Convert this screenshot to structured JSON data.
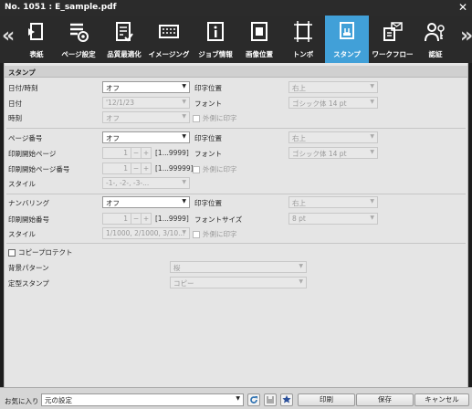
{
  "window": {
    "title": "No. 1051 : E_sample.pdf",
    "close_glyph": "✕"
  },
  "toolbar": {
    "tabs": [
      {
        "label": "表紙",
        "icon": "cover-icon"
      },
      {
        "label": "ページ設定",
        "icon": "page-settings-icon"
      },
      {
        "label": "品質最適化",
        "icon": "quality-icon"
      },
      {
        "label": "イメージング",
        "icon": "imaging-icon"
      },
      {
        "label": "ジョブ情報",
        "icon": "job-info-icon"
      },
      {
        "label": "画像位置",
        "icon": "image-position-icon"
      },
      {
        "label": "トンボ",
        "icon": "trim-marks-icon"
      },
      {
        "label": "スタンプ",
        "icon": "stamp-icon"
      },
      {
        "label": "ワークフロー",
        "icon": "workflow-icon"
      },
      {
        "label": "認証",
        "icon": "auth-icon"
      }
    ],
    "active_tab": "スタンプ",
    "accent": "#41a0d8"
  },
  "stamp": {
    "section_title": "スタンプ",
    "datetime": {
      "label": "日付/時刻",
      "value": "オフ",
      "position_label": "印字位置",
      "position_value": "右上",
      "date_label": "日付",
      "date_value": "'12/1/23",
      "font_label": "フォント",
      "font_value": "ゴシック体 14 pt",
      "time_label": "時刻",
      "time_value": "オフ",
      "outside_label": "外側に印字"
    },
    "page_number": {
      "label": "ページ番号",
      "value": "オフ",
      "position_label": "印字位置",
      "position_value": "右上",
      "start_page_label": "印刷開始ページ",
      "start_page_value": "1",
      "start_page_range": "[1...9999]",
      "font_label": "フォント",
      "font_value": "ゴシック体 14 pt",
      "start_number_label": "印刷開始ページ番号",
      "start_number_value": "1",
      "start_number_range": "[1...99999]",
      "outside_label": "外側に印字",
      "style_label": "スタイル",
      "style_value": "-1-, -2-, -3-..."
    },
    "numbering": {
      "label": "ナンバリング",
      "value": "オフ",
      "position_label": "印字位置",
      "position_value": "右上",
      "start_label": "印刷開始番号",
      "start_value": "1",
      "start_range": "[1...9999]",
      "font_size_label": "フォントサイズ",
      "font_size_value": "8 pt",
      "style_label": "スタイル",
      "style_value": "1/1000, 2/1000, 3/10...",
      "outside_label": "外側に印字"
    },
    "copy_protect": {
      "label": "コピープロテクト",
      "background_label": "背景パターン",
      "background_value": "桜",
      "fixed_stamp_label": "定型スタンプ",
      "fixed_stamp_value": "コピー"
    }
  },
  "footer": {
    "favorites_label": "お気に入り",
    "favorites_value": "元の設定",
    "print_label": "印刷",
    "save_label": "保存",
    "cancel_label": "キャンセル"
  }
}
